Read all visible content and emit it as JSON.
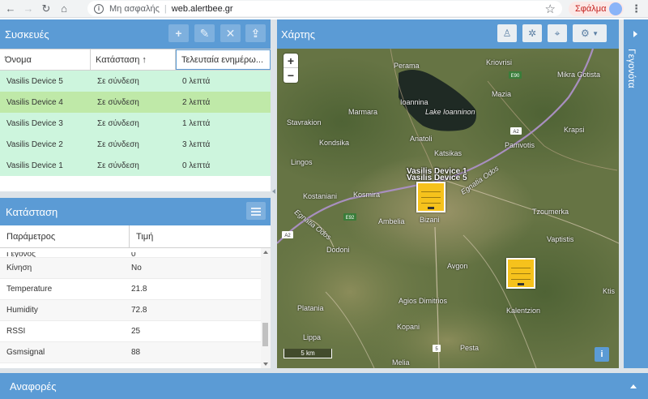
{
  "browser": {
    "insecure_label": "Μη ασφαλής",
    "url": "web.alertbee.gr",
    "error_label": "Σφάλμα"
  },
  "devices_panel": {
    "title": "Συσκευές",
    "toolbar_icons": [
      "add-icon",
      "edit-icon",
      "delete-icon",
      "upload-icon"
    ],
    "columns": [
      "Όνομα",
      "Κατάσταση ↑",
      "Τελευταία ενημέρω..."
    ],
    "rows": [
      {
        "name": "Vasilis Device 5",
        "status": "Σε σύνδεση",
        "last_update": "0 λεπτά"
      },
      {
        "name": "Vasilis Device 4",
        "status": "Σε σύνδεση",
        "last_update": "2 λεπτά"
      },
      {
        "name": "Vasilis Device 3",
        "status": "Σε σύνδεση",
        "last_update": "1 λεπτά"
      },
      {
        "name": "Vasilis Device 2",
        "status": "Σε σύνδεση",
        "last_update": "3 λεπτά"
      },
      {
        "name": "Vasilis Device 1",
        "status": "Σε σύνδεση",
        "last_update": "0 λεπτά"
      }
    ]
  },
  "status_panel": {
    "title": "Κατάσταση",
    "columns": [
      "Παράμετρος",
      "Τιμή"
    ],
    "partial_row": {
      "param": "Γέγονος",
      "value": "0"
    },
    "rows": [
      {
        "param": "Κίνηση",
        "value": "No"
      },
      {
        "param": "Temperature",
        "value": "21.8"
      },
      {
        "param": "Humidity",
        "value": "72.8"
      },
      {
        "param": "RSSI",
        "value": "25"
      },
      {
        "param": "Gsmsignal",
        "value": "88"
      }
    ]
  },
  "map_panel": {
    "title": "Χάρτης",
    "zoom_in": "+",
    "zoom_out": "−",
    "scale_label": "5 km",
    "info_label": "i",
    "marker_labels": [
      "Vasilis Device 1",
      "Vasilis Device 5"
    ],
    "places": [
      "Perama",
      "Kriovrisi",
      "Mikra Gotista",
      "Ioannina",
      "Lake Ioanninon",
      "Mazia",
      "Marmara",
      "Stavrakion",
      "Anatoli",
      "Krapsi",
      "Kondsika",
      "Katsikas",
      "Pamvotis",
      "Lingos",
      "Kostaniani",
      "Kosmira",
      "Bizani",
      "Tzoumerka",
      "Ambelia",
      "Vaptistis",
      "Dodoni",
      "Avgon",
      "Platania",
      "Agios Dimitrios",
      "Kalentzion",
      "Kopani",
      "Lippa",
      "Pesta",
      "Melia",
      "Ktis",
      "Egnatia Odos"
    ],
    "road_shields": [
      "E90",
      "A2",
      "A2",
      "E92",
      "5"
    ]
  },
  "events_panel": {
    "title": "Γεγονότα"
  },
  "reports_panel": {
    "title": "Αναφορές"
  }
}
